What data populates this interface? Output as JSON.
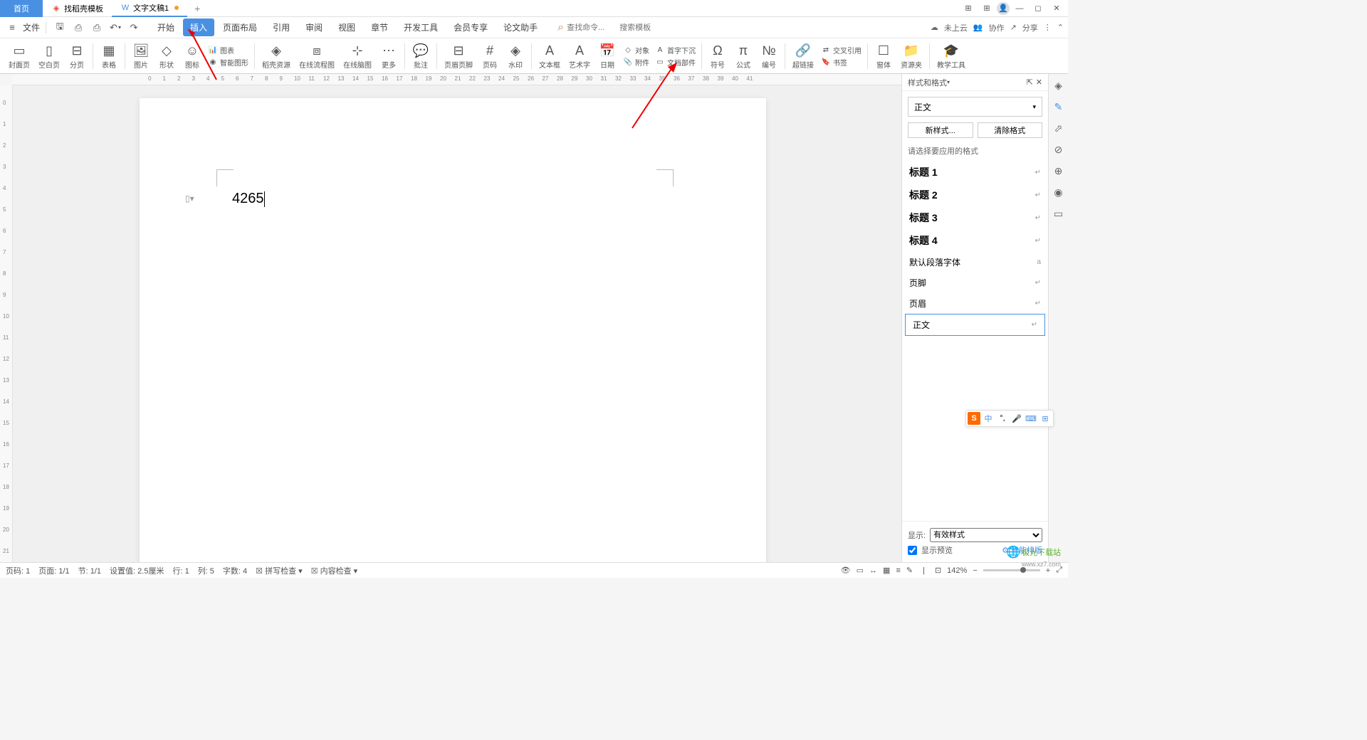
{
  "tabs": {
    "home": "首页",
    "tab1": "找稻壳模板",
    "tab2": "文字文稿1"
  },
  "window": {
    "cloud": "未上云",
    "coop": "协作",
    "share": "分享"
  },
  "menu": {
    "file": "文件",
    "items": [
      "开始",
      "插入",
      "页面布局",
      "引用",
      "审阅",
      "视图",
      "章节",
      "开发工具",
      "会员专享",
      "论文助手"
    ],
    "search_cmd": "查找命令...",
    "search_tpl": "搜索模板"
  },
  "ribbon": {
    "cover": "封面页",
    "blank": "空白页",
    "break": "分页",
    "table": "表格",
    "pic": "图片",
    "shape": "形状",
    "icon": "图标",
    "chart": "图表",
    "smart": "智能图形",
    "resource": "稻壳资源",
    "flowchart": "在线流程图",
    "mindmap": "在线脑图",
    "more": "更多",
    "batch": "批注",
    "header": "页眉页脚",
    "pagenum": "页码",
    "watermark": "水印",
    "textbox": "文本框",
    "wordart": "艺术字",
    "date": "日期",
    "object": "对象",
    "attach": "附件",
    "dropcap": "首字下沉",
    "docpart": "文档部件",
    "symbol": "符号",
    "formula": "公式",
    "number": "编号",
    "hyperlink": "超链接",
    "crossref": "交叉引用",
    "bookmark": "书签",
    "form": "窗体",
    "resource2": "资源夹",
    "teaching": "教学工具"
  },
  "document": {
    "text": "4265"
  },
  "panel": {
    "title": "样式和格式",
    "current": "正文",
    "new_style": "新样式...",
    "clear": "清除格式",
    "hint": "请选择要应用的格式",
    "styles": [
      {
        "name": "标题 1",
        "bold": true
      },
      {
        "name": "标题 2",
        "bold": true
      },
      {
        "name": "标题 3",
        "bold": true
      },
      {
        "name": "标题 4",
        "bold": true
      },
      {
        "name": "默认段落字体",
        "bold": false
      },
      {
        "name": "页脚",
        "bold": false
      },
      {
        "name": "页眉",
        "bold": false
      },
      {
        "name": "正文",
        "bold": false,
        "selected": true
      }
    ],
    "show": "显示:",
    "show_val": "有效样式",
    "preview": "显示预览",
    "smart_layout": "智能排版"
  },
  "status": {
    "page": "页码: 1",
    "pages": "页面: 1/1",
    "section": "节: 1/1",
    "pos": "设置值: 2.5厘米",
    "line": "行: 1",
    "col": "列: 5",
    "chars": "字数: 4",
    "spell": "拼写检查",
    "content": "内容检查",
    "zoom": "142%"
  },
  "watermark": {
    "text": "极光下载站",
    "url": "www.xz7.com"
  },
  "float": {
    "lang": "中"
  }
}
